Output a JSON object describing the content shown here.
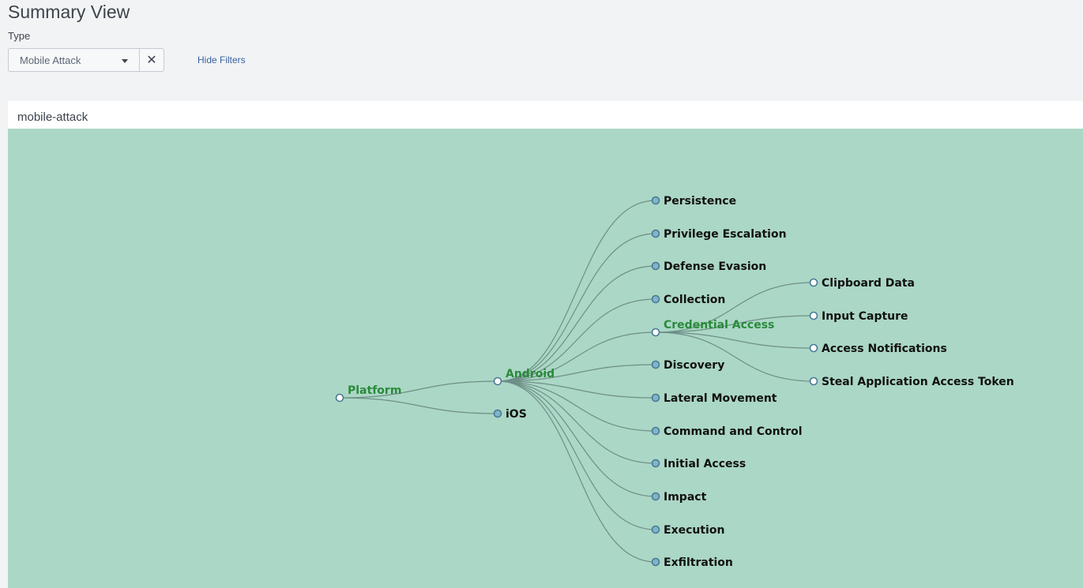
{
  "header": {
    "title": "Summary View"
  },
  "filters": {
    "type_label": "Type",
    "type_value": "Mobile Attack",
    "clear_glyph": "✕",
    "hide_filters_label": "Hide Filters"
  },
  "panel": {
    "title": "mobile-attack",
    "colors": {
      "background": "#abd7c6",
      "link": "#6e8f86",
      "expanded_label": "#2a8a3a",
      "leaf_label": "#111111",
      "collapsed_node_fill": "#7fb5c6",
      "open_node_fill": "#ffffff",
      "node_stroke": "#4a7a96"
    },
    "tree": {
      "name": "Platform",
      "children": [
        {
          "name": "Android",
          "children": [
            {
              "name": "Persistence"
            },
            {
              "name": "Privilege Escalation"
            },
            {
              "name": "Defense Evasion"
            },
            {
              "name": "Collection"
            },
            {
              "name": "Credential Access",
              "children": [
                {
                  "name": "Clipboard Data"
                },
                {
                  "name": "Input Capture"
                },
                {
                  "name": "Access Notifications"
                },
                {
                  "name": "Steal Application Access Token"
                }
              ]
            },
            {
              "name": "Discovery"
            },
            {
              "name": "Lateral Movement"
            },
            {
              "name": "Command and Control"
            },
            {
              "name": "Initial Access"
            },
            {
              "name": "Impact"
            },
            {
              "name": "Execution"
            },
            {
              "name": "Exfiltration"
            }
          ]
        },
        {
          "name": "iOS",
          "collapsed": true
        }
      ]
    }
  }
}
